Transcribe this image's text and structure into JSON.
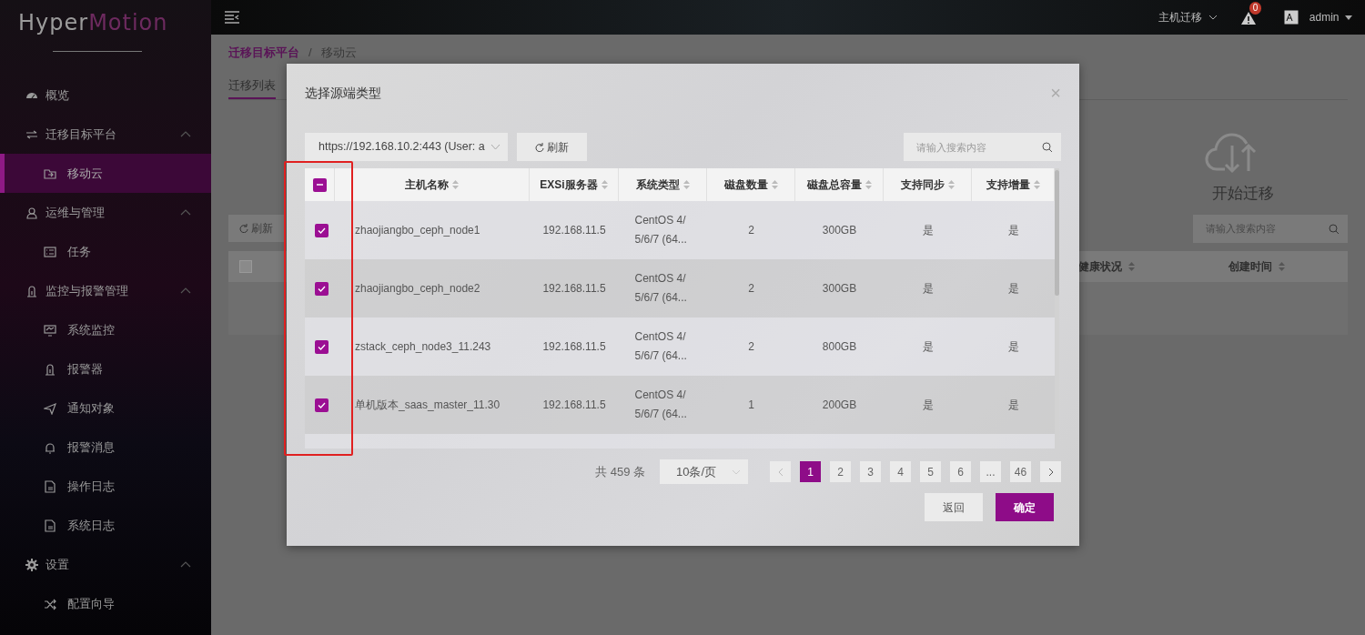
{
  "logo": {
    "first": "Hyper",
    "second": "Motion"
  },
  "sidebar": {
    "items": [
      {
        "label": "概览"
      },
      {
        "label": "迁移目标平台",
        "expanded": true,
        "children": [
          {
            "label": "移动云",
            "selected": true
          }
        ]
      },
      {
        "label": "运维与管理",
        "expanded": true,
        "children": [
          {
            "label": "任务",
            "selected": false
          }
        ]
      },
      {
        "label": "监控与报警管理",
        "expanded": true,
        "children": [
          {
            "label": "系统监控",
            "selected": false
          },
          {
            "label": "报警器",
            "selected": false
          },
          {
            "label": "通知对象",
            "selected": false
          },
          {
            "label": "报警消息",
            "selected": false
          },
          {
            "label": "操作日志",
            "selected": false
          },
          {
            "label": "系统日志",
            "selected": false
          }
        ]
      },
      {
        "label": "设置",
        "expanded": true,
        "children": [
          {
            "label": "配置向导",
            "selected": false
          }
        ]
      }
    ]
  },
  "topbar": {
    "menu": "主机迁移",
    "alert_count": "0",
    "user": "admin"
  },
  "page": {
    "breadcrumb": [
      "迁移目标平台",
      "移动云"
    ],
    "breadcrumb_separator": "/",
    "tabs": [
      {
        "label": "迁移列表",
        "selected": true
      }
    ],
    "refresh": "刷新",
    "start": "开始迁移",
    "search": {
      "placeholder": "请输入搜索内容"
    },
    "select_all": {
      "checked": false
    },
    "columns": [
      "健康状况",
      "创建时间"
    ]
  },
  "modal": {
    "title": "选择源端类型",
    "close": "×",
    "source": {
      "value": "https://192.168.10.2:443 (User: a"
    },
    "refresh": "刷新",
    "search": {
      "placeholder": "请输入搜索内容"
    },
    "select_all": {
      "indeterminate": true
    },
    "columns": [
      "主机名称",
      "EXSi服务器",
      "系统类型",
      "磁盘数量",
      "磁盘总容量",
      "支持同步",
      "支持增量"
    ],
    "rows": [
      {
        "checked": true,
        "cells": [
          "zhaojiangbo_ceph_node1",
          "192.168.11.5",
          "CentOS 4/5/6/7 (64...",
          "2",
          "300GB",
          "是",
          "是"
        ]
      },
      {
        "checked": true,
        "cells": [
          "zhaojiangbo_ceph_node2",
          "192.168.11.5",
          "CentOS 4/5/6/7 (64...",
          "2",
          "300GB",
          "是",
          "是"
        ]
      },
      {
        "checked": true,
        "cells": [
          "zstack_ceph_node3_11.243",
          "192.168.11.5",
          "CentOS 4/5/6/7 (64...",
          "2",
          "800GB",
          "是",
          "是"
        ]
      },
      {
        "checked": true,
        "cells": [
          "单机版本_saas_master_11.30",
          "192.168.11.5",
          "CentOS 4/5/6/7 (64...",
          "1",
          "200GB",
          "是",
          "是"
        ]
      }
    ],
    "pagination": {
      "total": "共 459 条",
      "page_size": "10条/页",
      "pages": [
        {
          "label": "1",
          "selected": true
        },
        {
          "label": "2",
          "selected": false
        },
        {
          "label": "3",
          "selected": false
        },
        {
          "label": "4",
          "selected": false
        },
        {
          "label": "5",
          "selected": false
        },
        {
          "label": "6",
          "selected": false
        },
        {
          "label": "...",
          "selected": false
        },
        {
          "label": "46",
          "selected": false
        }
      ]
    },
    "buttons": [
      {
        "label": "返回",
        "kind": "secondary"
      },
      {
        "label": "确定",
        "kind": "primary"
      }
    ]
  }
}
